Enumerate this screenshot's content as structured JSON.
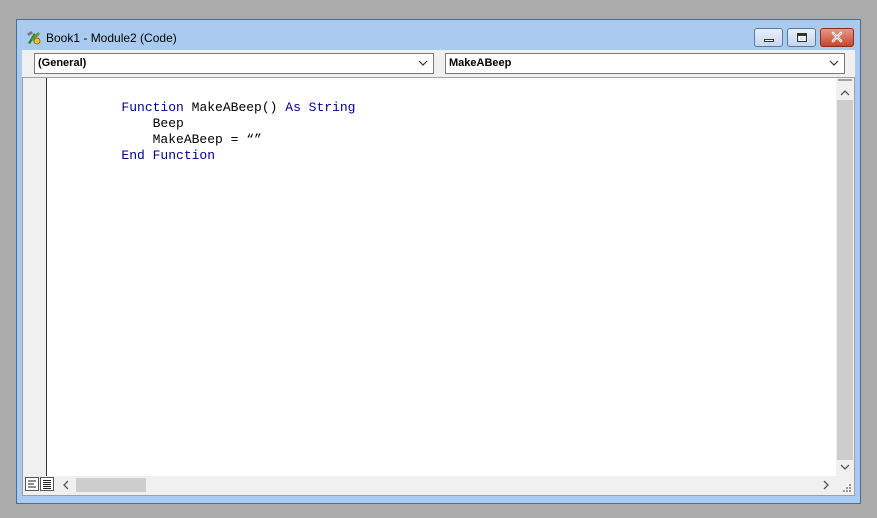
{
  "window": {
    "title": "Book1 - Module2 (Code)"
  },
  "toolbar": {
    "object_combo": {
      "selected": "(General)"
    },
    "procedure_combo": {
      "selected": "MakeABeep"
    }
  },
  "code": {
    "lines": [
      {
        "parts": [
          {
            "text": "Function",
            "kind": "keyword"
          },
          {
            "text": " MakeABeep() ",
            "kind": "plain"
          },
          {
            "text": "As String",
            "kind": "keyword"
          }
        ]
      },
      {
        "parts": [
          {
            "text": "    Beep",
            "kind": "plain"
          }
        ]
      },
      {
        "parts": [
          {
            "text": "    MakeABeep = “”",
            "kind": "plain"
          }
        ]
      },
      {
        "parts": [
          {
            "text": "End Function",
            "kind": "keyword"
          }
        ]
      }
    ]
  },
  "icons": {
    "app": "vba-module-icon",
    "minimize": "minimize-icon",
    "maximize": "maximize-icon",
    "close": "close-icon",
    "dropdown": "chevron-down-icon",
    "scroll_up": "chevron-up-icon",
    "scroll_down": "chevron-down-icon",
    "scroll_left": "chevron-left-icon",
    "scroll_right": "chevron-right-icon",
    "procedure_view": "procedure-view-icon",
    "full_module_view": "full-module-view-icon",
    "size_grip": "size-grip-icon"
  },
  "colors": {
    "keyword": "#00008b",
    "plain": "#000000",
    "frame": "#aacbf0",
    "desktop": "#ababab"
  }
}
